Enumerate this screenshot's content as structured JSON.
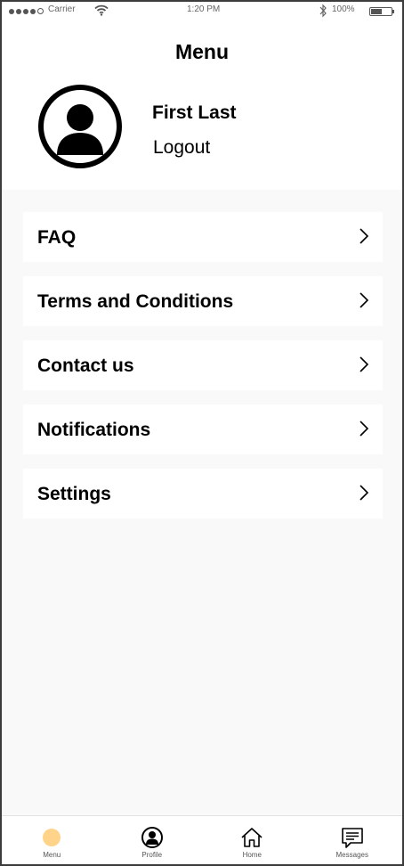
{
  "status_bar": {
    "carrier": "Carrier",
    "time": "1:20 PM",
    "battery_pct": "100%",
    "battery_level": 0.55
  },
  "header": {
    "title": "Menu",
    "user_name": "First Last",
    "logout_label": "Logout"
  },
  "menu": {
    "items": [
      {
        "label": "FAQ"
      },
      {
        "label": "Terms and Conditions"
      },
      {
        "label": "Contact us"
      },
      {
        "label": "Notifications"
      },
      {
        "label": "Settings"
      }
    ]
  },
  "tab_bar": {
    "tabs": [
      {
        "label": "Menu",
        "icon": "menu-dot-icon",
        "active": true
      },
      {
        "label": "Profile",
        "icon": "profile-icon"
      },
      {
        "label": "Home",
        "icon": "home-icon"
      },
      {
        "label": "Messages",
        "icon": "messages-icon"
      }
    ],
    "active_color": "#ffd48a"
  },
  "colors": {
    "background": "#f9f9f9",
    "card": "#ffffff",
    "text": "#000000"
  }
}
